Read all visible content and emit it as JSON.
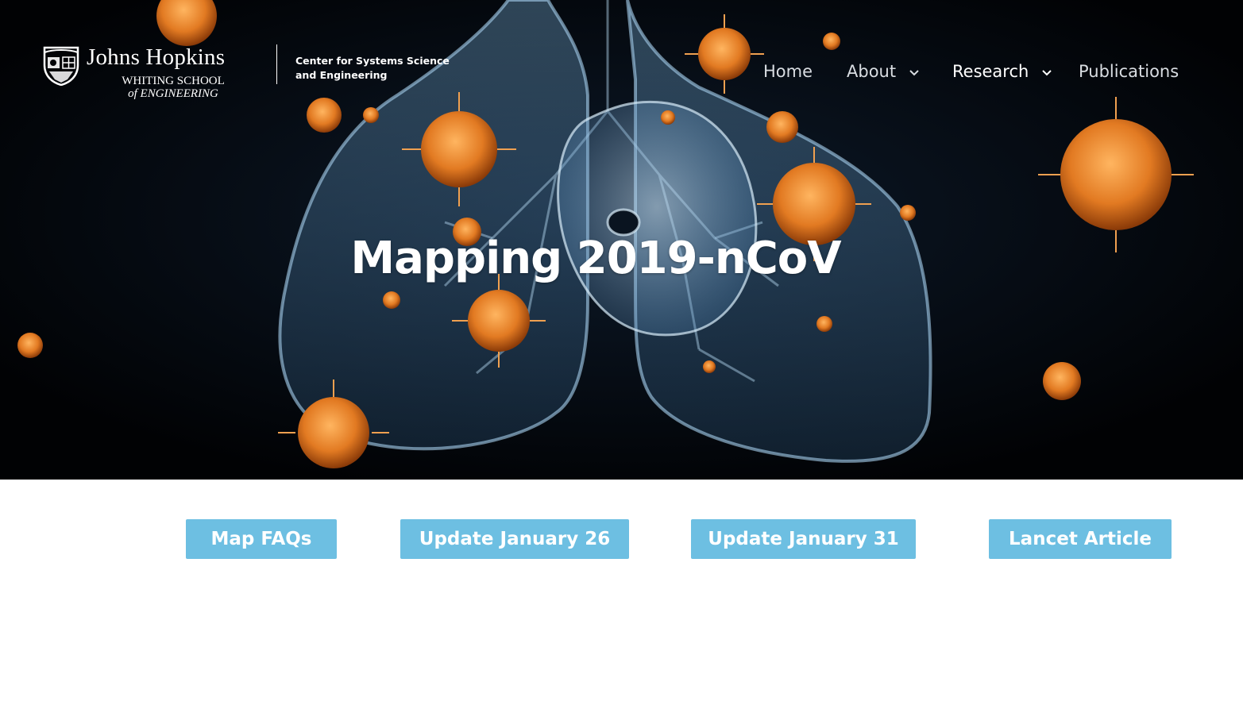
{
  "brand": {
    "university": "Johns Hopkins",
    "school_line1": "WHITING SCHOOL",
    "school_line2": "of ENGINEERING",
    "center_line1": "Center for Systems Science",
    "center_line2": "and Engineering"
  },
  "nav": {
    "home": "Home",
    "about": "About",
    "research": "Research",
    "publications": "Publications"
  },
  "hero": {
    "title": "Mapping 2019-nCoV"
  },
  "buttons": {
    "faq": "Map FAQs",
    "update_jan26": "Update January 26",
    "update_jan31": "Update January 31",
    "lancet": "Lancet Article"
  },
  "colors": {
    "button_bg": "#6dbfe2",
    "hero_bg": "#020407",
    "virus": "#e8832c",
    "lung": "#6aa6d6"
  },
  "icons": {
    "shield": "johns-hopkins-shield-icon",
    "dropdown": "chevron-down-icon"
  }
}
